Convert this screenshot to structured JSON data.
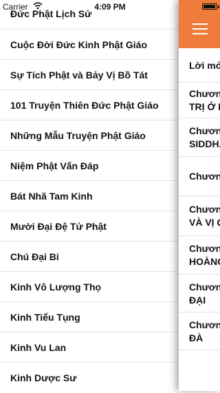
{
  "status_bar": {
    "carrier": "Carrier",
    "time": "4:09 PM"
  },
  "menu_items": [
    "Đức Phật Lịch Sử",
    "Cuộc Đời Đức Kinh Phật Giáo",
    "Sự Tích Phật và Bảy Vị Bồ Tát",
    "101 Truyện Thiên Đức Phật Giáo",
    "Những Mẫu Truyện Phật Giáo",
    "Niệm Phật Vấn Đáp",
    "Bát Nhã Tam Kinh",
    "Mười Đại Đệ Tử Phật",
    "Chú Đại Bi",
    "Kinh Vô Lượng Thọ",
    "Kinh Tiểu Tụng",
    "Kinh Vu Lan",
    "Kinh Dược Sư"
  ],
  "chapters": [
    {
      "line1": "Lời mở"
    },
    {
      "line1": "Chươn",
      "line2": "TRỊ Ở E"
    },
    {
      "line1": "Chươn",
      "line2": "SIDDHA"
    },
    {
      "line1": "Chươn"
    },
    {
      "line1": "Chươn",
      "line2": "VÀ VỊ Q"
    },
    {
      "line1": "Chươn",
      "line2": "HOÀNG"
    },
    {
      "line1": "Chươn",
      "line2": "ĐẠI"
    },
    {
      "line1": "Chươn",
      "line2": "ĐÀ"
    }
  ]
}
